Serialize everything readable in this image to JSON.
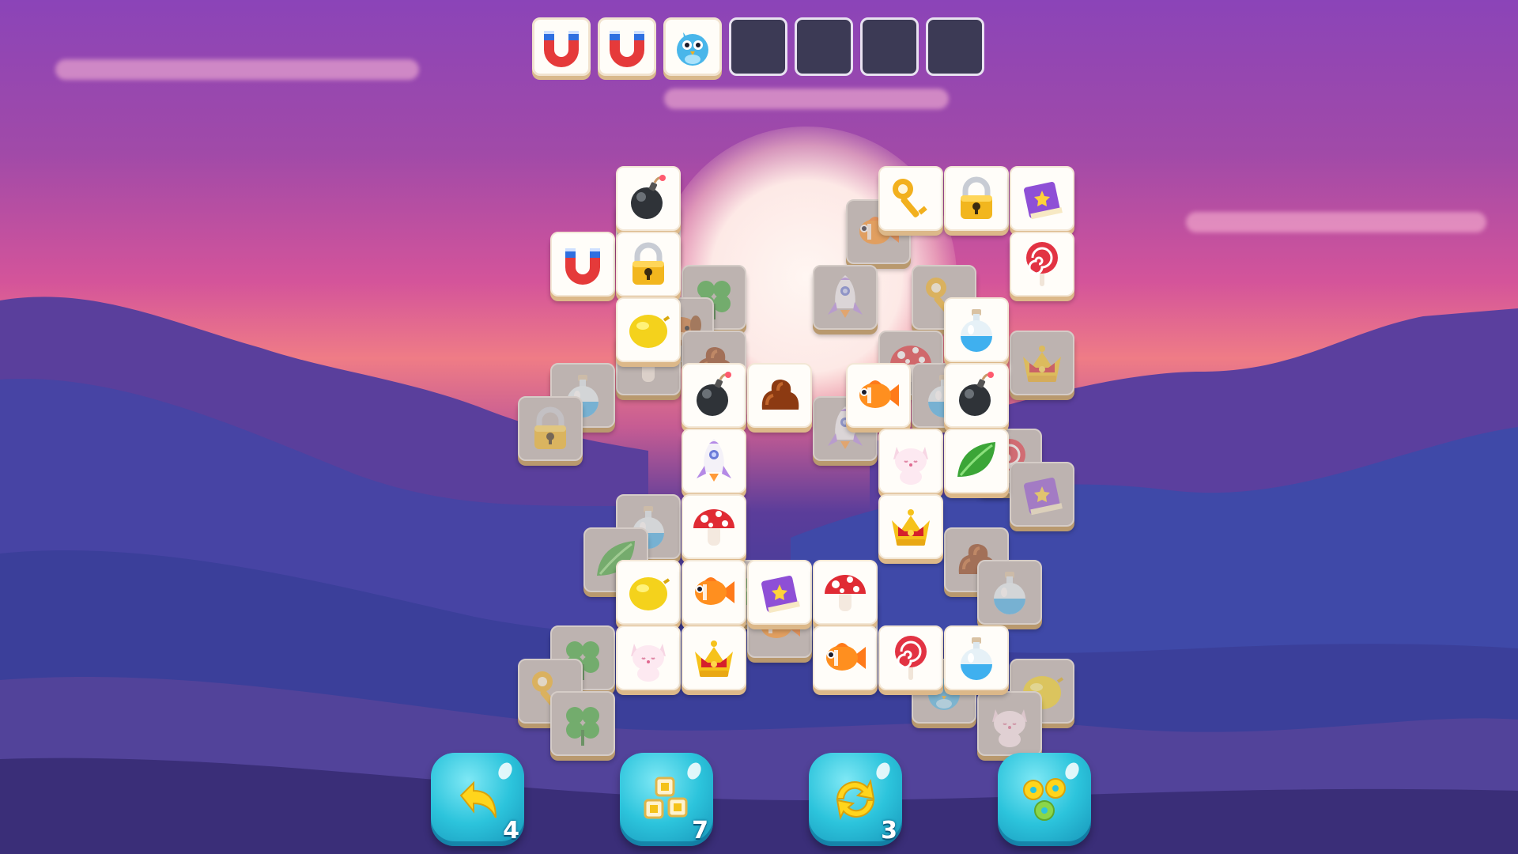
{
  "slot_bar": {
    "capacity": 7,
    "filled": [
      "magnet",
      "magnet",
      "bird"
    ]
  },
  "board": {
    "lower_tiles": [
      {
        "c": 9,
        "r": 2.5,
        "icon": "mushroom"
      },
      {
        "c": 10,
        "r": 3.5,
        "icon": "clover"
      },
      {
        "c": 9.5,
        "r": 4,
        "icon": "dog"
      },
      {
        "c": 10,
        "r": 4.5,
        "icon": "chocolate"
      },
      {
        "c": 9,
        "r": 4.5,
        "icon": "mushroom"
      },
      {
        "c": 8,
        "r": 5,
        "icon": "potion"
      },
      {
        "c": 7.5,
        "r": 5.5,
        "icon": "lock"
      },
      {
        "c": 12.5,
        "r": 2.5,
        "icon": "fish"
      },
      {
        "c": 12,
        "r": 3.5,
        "icon": "rocket"
      },
      {
        "c": 13.5,
        "r": 3.5,
        "icon": "key"
      },
      {
        "c": 13,
        "r": 4.5,
        "icon": "mushroom"
      },
      {
        "c": 15,
        "r": 4.5,
        "icon": "crown"
      },
      {
        "c": 13.5,
        "r": 5,
        "icon": "potion"
      },
      {
        "c": 12,
        "r": 5.5,
        "icon": "rocket"
      },
      {
        "c": 14.5,
        "r": 6,
        "icon": "lollipop"
      },
      {
        "c": 15,
        "r": 6.5,
        "icon": "book"
      },
      {
        "c": 9,
        "r": 7,
        "icon": "potion"
      },
      {
        "c": 8.5,
        "r": 7.5,
        "icon": "leaf"
      },
      {
        "c": 9,
        "r": 8,
        "icon": "bird"
      },
      {
        "c": 10.5,
        "r": 8,
        "icon": "leaf"
      },
      {
        "c": 11,
        "r": 8.5,
        "icon": "fish"
      },
      {
        "c": 12,
        "r": 8.5,
        "icon": "mushroom"
      },
      {
        "c": 14,
        "r": 7.5,
        "icon": "chocolate"
      },
      {
        "c": 14.5,
        "r": 8,
        "icon": "potion"
      },
      {
        "c": 8,
        "r": 9,
        "icon": "clover"
      },
      {
        "c": 7.5,
        "r": 9.5,
        "icon": "key"
      },
      {
        "c": 8,
        "r": 10,
        "icon": "clover"
      },
      {
        "c": 13.5,
        "r": 9.5,
        "icon": "bird"
      },
      {
        "c": 15,
        "r": 9.5,
        "icon": "lemon"
      },
      {
        "c": 14.5,
        "r": 10,
        "icon": "cat"
      }
    ],
    "top_tiles": [
      {
        "c": 9,
        "r": 2,
        "icon": "bomb"
      },
      {
        "c": 8,
        "r": 3,
        "icon": "magnet"
      },
      {
        "c": 9,
        "r": 3,
        "icon": "lock"
      },
      {
        "c": 9,
        "r": 4,
        "icon": "lemon"
      },
      {
        "c": 13,
        "r": 2,
        "icon": "key"
      },
      {
        "c": 14,
        "r": 2,
        "icon": "lock"
      },
      {
        "c": 15,
        "r": 2,
        "icon": "book"
      },
      {
        "c": 15,
        "r": 3,
        "icon": "lollipop"
      },
      {
        "c": 14,
        "r": 4,
        "icon": "potion"
      },
      {
        "c": 10,
        "r": 5,
        "icon": "bomb"
      },
      {
        "c": 11,
        "r": 5,
        "icon": "chocolate"
      },
      {
        "c": 12.5,
        "r": 5,
        "icon": "fish"
      },
      {
        "c": 14,
        "r": 5,
        "icon": "bomb"
      },
      {
        "c": 10,
        "r": 6,
        "icon": "rocket"
      },
      {
        "c": 13,
        "r": 6,
        "icon": "cat"
      },
      {
        "c": 14,
        "r": 6,
        "icon": "leaf"
      },
      {
        "c": 10,
        "r": 7,
        "icon": "mushroom"
      },
      {
        "c": 13,
        "r": 7,
        "icon": "crown"
      },
      {
        "c": 9,
        "r": 8,
        "icon": "lemon"
      },
      {
        "c": 10,
        "r": 8,
        "icon": "fish"
      },
      {
        "c": 11,
        "r": 8,
        "icon": "book"
      },
      {
        "c": 12,
        "r": 8,
        "icon": "mushroom"
      },
      {
        "c": 9,
        "r": 9,
        "icon": "cat"
      },
      {
        "c": 10,
        "r": 9,
        "icon": "crown"
      },
      {
        "c": 12,
        "r": 9,
        "icon": "fish"
      },
      {
        "c": 13,
        "r": 9,
        "icon": "lollipop"
      },
      {
        "c": 14,
        "r": 9,
        "icon": "potion"
      }
    ]
  },
  "toolbar": [
    {
      "id": "undo",
      "icon": "undo-arrow-icon",
      "count": "4"
    },
    {
      "id": "hint",
      "icon": "tiles-hint-icon",
      "count": "7"
    },
    {
      "id": "shuffle",
      "icon": "shuffle-icon",
      "count": "3"
    },
    {
      "id": "settings",
      "icon": "gears-icon",
      "count": ""
    }
  ]
}
